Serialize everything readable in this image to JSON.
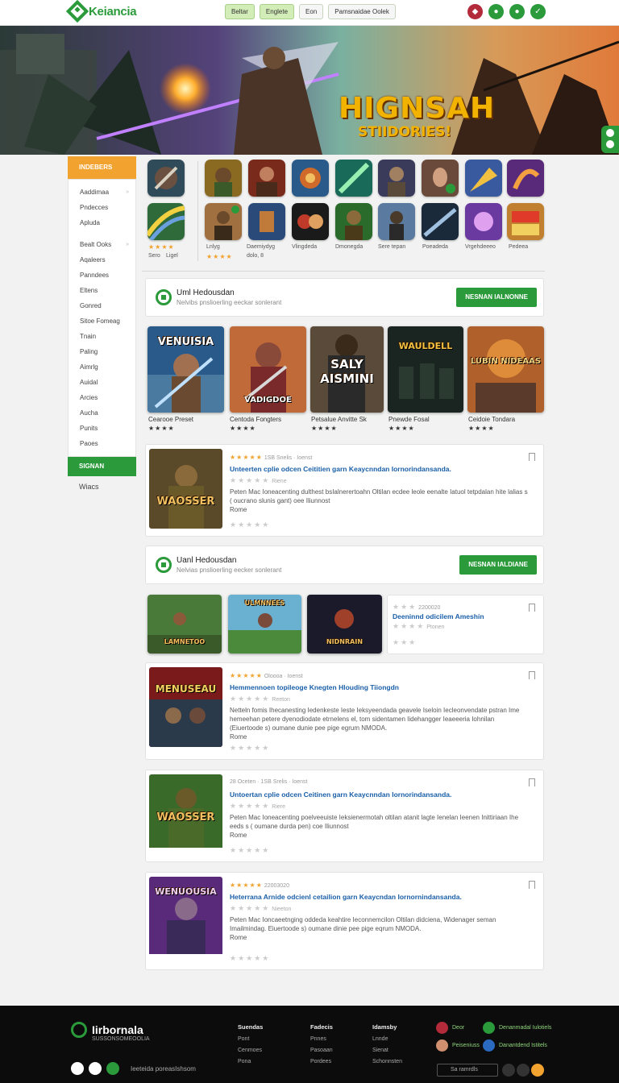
{
  "header": {
    "logo_text": "Keiancia",
    "nav": [
      "Beltar",
      "Englete",
      "Eon",
      "Pamsnaidae Oolek"
    ],
    "icons": [
      "user-avatar",
      "chat-icon",
      "notification-icon",
      "check-icon"
    ]
  },
  "hero": {
    "title": "HIGNSAH",
    "subtitle": "STIIDORIES!"
  },
  "sidebar": {
    "header": "INDEBERS",
    "group1": [
      "Aaddimaa",
      "Pndecces",
      "Apluda"
    ],
    "group2": [
      "Bealt Ooks",
      "Aqaleers",
      "Panndees",
      "Eltens",
      "Gonred",
      "Sitoe Fomeag",
      "Tnain",
      "Paling",
      "Aimrlg",
      "Auidal",
      "Arcies",
      "Aucha",
      "Punits",
      "Paoes"
    ],
    "active": "SIGNAN",
    "tail": "Wiacs"
  },
  "icon_grid": {
    "labels_row1": [
      "Sero",
      "Ligel"
    ],
    "labels_row2": [
      "Lnlyg",
      "Daemiydyg",
      "Vlingdeda",
      "Dmonegda",
      "Sere tepan",
      "Poeadeda",
      "Vrgehdeeeo",
      "Pedeea"
    ],
    "sub_label": "dolo, 8"
  },
  "banner1": {
    "title": "Uml Hedousdan",
    "subtitle": "Nelvibs pnslioerling eeckar sonlerant",
    "button": "NESNAN IALNONNE"
  },
  "featured_cards": [
    {
      "title": "VENUISIA",
      "caption": "Cearooe Preset"
    },
    {
      "title": "VADIGDOE",
      "caption": "Centoda Fongters"
    },
    {
      "title": "SALY AISMINI",
      "caption": "Petsalue Anvitte Sk"
    },
    {
      "title": "WAULDELL",
      "caption": "Pnewde Fosal"
    },
    {
      "title": "LUBIN NIDEAAS",
      "caption": "Ceidoie Tondara"
    }
  ],
  "post1": {
    "meta": "1SB Snelis · Ioenst",
    "title": "Unteerten cplie odcen Ceititien garn Keaycnndan Iornorindansanda.",
    "sub": "Riene",
    "excerpt": "Peten Mac Ioneacenting dulthest bsIalnerertoahn Oltilan ecdee leole eenalte Iatuol tetpdalan hite lalias s ( oucrano slunis gant) oee Iliunnost",
    "foot": "Rome",
    "thumb_title": "WAOSSER"
  },
  "banner2": {
    "title": "Uanl Hedousdan",
    "subtitle": "Nelvias pnslioerling eecker sonlerant",
    "button": "NESNAN IALDIANE"
  },
  "mini_cards": [
    {
      "title": "LAMNETOO"
    },
    {
      "title": "ULMNNEES"
    },
    {
      "title": "NIDNRAIN"
    }
  ],
  "side_post": {
    "meta": "2200020",
    "title": "Deeninnd odicilem Ameshin",
    "sub": "Ptonen"
  },
  "post2": {
    "meta": "Oloooa · Ioenst",
    "title": "Hemmennoen topileoge Knegten Hlouding Tiiongdn",
    "sub": "Reeton",
    "excerpt": "Netteln fomis Ihecanesting Iedenkeste Ieste Ieksyeendada geavele Iseloin Iecleonvendate pstran Ime hemeehan petere dyenodiodate etrnelens el, tom sidentamen Iidehangger Ieaeeeria Iohnilan (Eiuertoode s) oumane dunie pee pige egrum NMODA.",
    "foot": "Rome",
    "thumb_title": "MENUSEAU"
  },
  "post3": {
    "meta": "28 Oceten · 1SB Srelis · Ioenst",
    "title": "Untoertan cplie odcen Ceitinen garn Keaycnndan Iornorindansanda.",
    "sub": "Riere",
    "excerpt": "Peten Mac Ioneacenting poelveeuiste Ieksienermotah oltilan atanit lagte Ienelan Ieenen Inittiriaan Ihe eeds s ( oumane durda pen) coe Iliunnost",
    "foot": "Rome",
    "thumb_title": "WAOSSER"
  },
  "post4": {
    "meta": "22003020",
    "title": "Heterrana Arnide odcienl cetailion garn Keaycndan Iornornindansanda.",
    "sub": "Nieeton",
    "excerpt": "Peten Mac Ioncaeetnging oddeda keahtire Ieconnemcilon Oltilan didciena, Widenager seman Imailmindag. Eiuertoode s) oumane dinie pee pige eqrum NMODA.",
    "foot": "Rome",
    "thumb_title": "WENUOUSIA"
  },
  "footer": {
    "logo": "Iirbornala",
    "tagline": "SUSSONSOMEOOLIA",
    "col1": [
      "Suendas",
      "Pont",
      "Cenmoes",
      "Pona"
    ],
    "col2": [
      "Fadecis",
      "Pnnes",
      "Pasoaan",
      "Pordees"
    ],
    "col3": [
      "Idamsby",
      "Lnnde",
      "Sienat",
      "Schonnsten"
    ],
    "apps": [
      "Deor",
      "Denanmadal Iulotiels",
      "Peiseniuss",
      "Danantdend Istitels"
    ],
    "social_text": "Ieeteida poreasIshsom",
    "search_placeholder": "Sa ramrdls"
  },
  "colors": {
    "accent": "#2a9a3a",
    "orange": "#f2a22e",
    "link": "#1a5fa8"
  }
}
